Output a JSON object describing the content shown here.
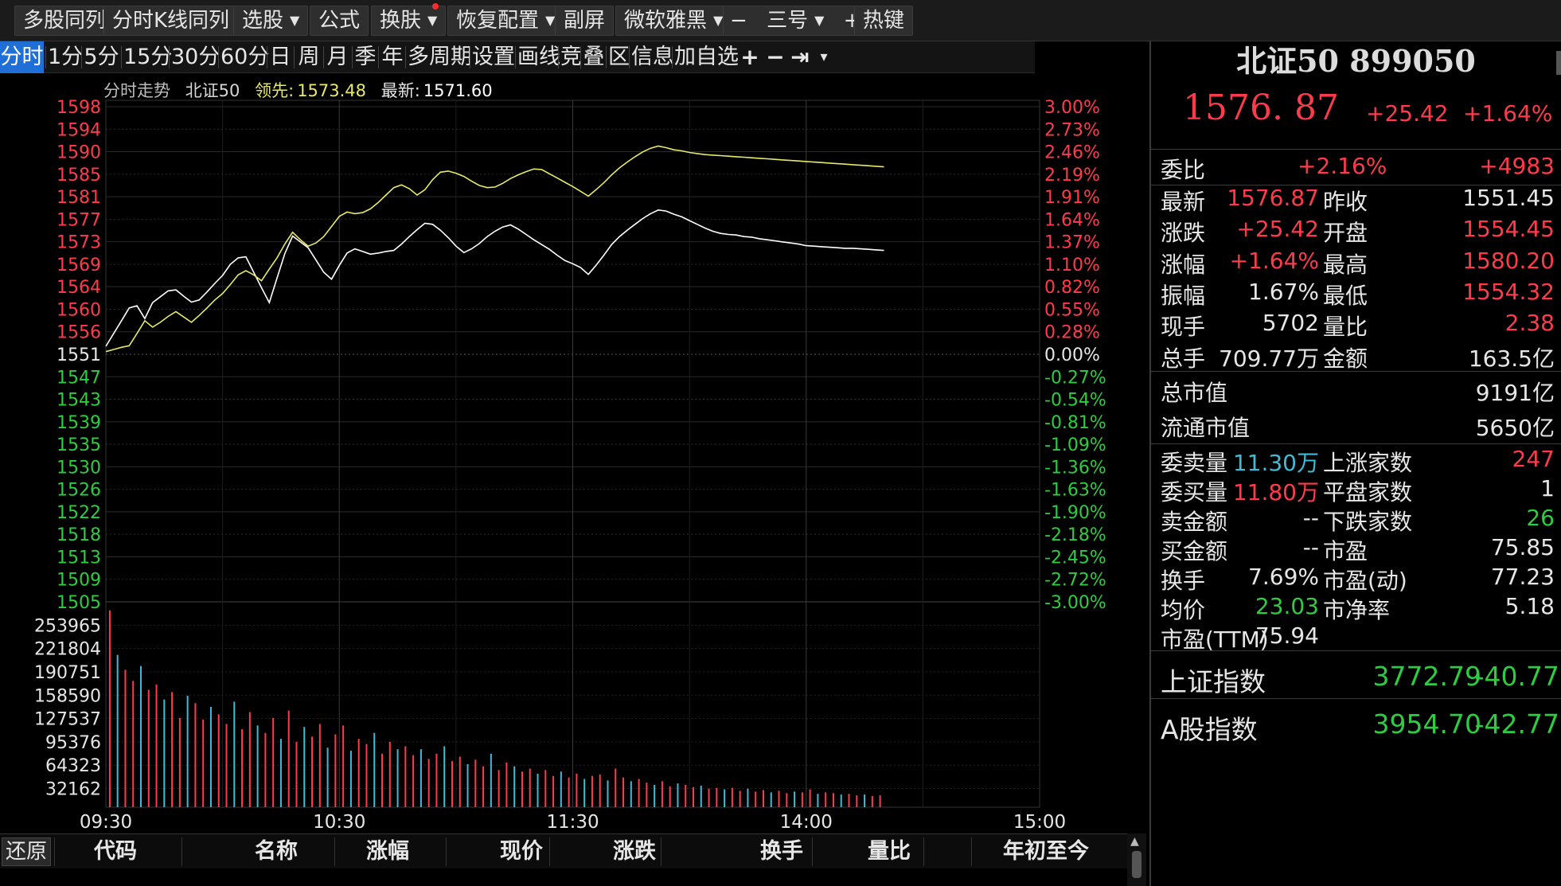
{
  "toolbar": {
    "items": [
      {
        "label": "多股同列",
        "caret": false
      },
      {
        "label": "分时K线同列",
        "caret": false
      },
      {
        "label": "选股",
        "caret": true
      },
      {
        "label": "公式",
        "caret": false
      },
      {
        "label": "换肤",
        "caret": true
      },
      {
        "label": "恢复配置",
        "caret": true
      },
      {
        "label": "副屏",
        "caret": false
      },
      {
        "label": "微软雅黑",
        "caret": true
      },
      {
        "label": "三号",
        "caret": true
      },
      {
        "label": "热键",
        "caret": false
      }
    ],
    "font_minus": "−",
    "font_plus": "+"
  },
  "periods": {
    "items": [
      "分时",
      "1分",
      "5分",
      "15分",
      "30分",
      "60分",
      "日",
      "周",
      "月",
      "季",
      "年",
      "多周期",
      "设置",
      "画线",
      "竞",
      "叠",
      "区",
      "信息",
      "加自选"
    ],
    "active": "分时",
    "tools": [
      "+",
      "−",
      "⇥",
      "▾"
    ]
  },
  "chart_info": {
    "label": "分时走势",
    "name": "北证50",
    "lead_label": "领先:",
    "lead_value": "1573.48",
    "latest_label": "最新:",
    "latest_value": "1571.60"
  },
  "chart_data": {
    "type": "line",
    "prev_close": 1551.45,
    "ylim": [
      1505,
      1598
    ],
    "price_ticks": [
      "1598",
      "1594",
      "1590",
      "1585",
      "1581",
      "1577",
      "1573",
      "1569",
      "1564",
      "1560",
      "1556",
      "1551",
      "1547",
      "1543",
      "1539",
      "1535",
      "1530",
      "1526",
      "1522",
      "1518",
      "1513",
      "1509",
      "1505"
    ],
    "pct_ticks": [
      "3.00%",
      "2.73%",
      "2.46%",
      "2.19%",
      "1.91%",
      "1.64%",
      "1.37%",
      "1.10%",
      "0.82%",
      "0.55%",
      "0.28%",
      "0.00%",
      "-0.27%",
      "-0.54%",
      "-0.81%",
      "-1.09%",
      "-1.36%",
      "-1.63%",
      "-1.90%",
      "-2.18%",
      "-2.45%",
      "-2.72%",
      "-3.00%"
    ],
    "volume_ticks": [
      "253965",
      "221804",
      "190751",
      "158590",
      "127537",
      "95376",
      "64323",
      "32162"
    ],
    "volume_max": 270000,
    "time_labels": [
      "09:30",
      "10:30",
      "11:30",
      "14:00",
      "15:00"
    ],
    "total_minutes": 240,
    "series": [
      {
        "name": "最新",
        "color": "#ffffff",
        "x": [
          0,
          2,
          4,
          6,
          8,
          10,
          12,
          14,
          16,
          18,
          20,
          22,
          24,
          26,
          28,
          30,
          32,
          34,
          36,
          38,
          40,
          42,
          44,
          46,
          48,
          50,
          52,
          54,
          56,
          58,
          60,
          62,
          64,
          66,
          68,
          70,
          72,
          74,
          76,
          78,
          80,
          82,
          84,
          86,
          88,
          90,
          92,
          94,
          96,
          98,
          100,
          102,
          104,
          106,
          108,
          110,
          112,
          114,
          116,
          118,
          120,
          122,
          124,
          126,
          128,
          130,
          132,
          134,
          136,
          138,
          140,
          142,
          144,
          146,
          148,
          150,
          152,
          154,
          156,
          158,
          160,
          162,
          164,
          166,
          168,
          170,
          172,
          174,
          176,
          178,
          180,
          182,
          184,
          186,
          188,
          190,
          192,
          194,
          196,
          198,
          200
        ],
        "values": [
          1553.0,
          1555.4,
          1557.8,
          1560.2,
          1560.6,
          1558.2,
          1561.2,
          1562.3,
          1563.4,
          1563.6,
          1562.4,
          1561.3,
          1561.7,
          1563.2,
          1564.8,
          1566.3,
          1568.4,
          1569.6,
          1569.8,
          1566.9,
          1564.0,
          1561.2,
          1565.8,
          1570.4,
          1573.7,
          1572.6,
          1571.5,
          1569.2,
          1566.9,
          1565.6,
          1568.2,
          1570.5,
          1571.3,
          1570.8,
          1570.3,
          1570.5,
          1570.8,
          1571.0,
          1572.2,
          1573.6,
          1574.9,
          1576.1,
          1575.9,
          1574.8,
          1573.4,
          1571.8,
          1570.6,
          1571.3,
          1572.3,
          1573.6,
          1574.6,
          1575.4,
          1575.8,
          1575.0,
          1574.0,
          1573.0,
          1572.1,
          1571.2,
          1570.1,
          1569.1,
          1568.5,
          1567.8,
          1566.5,
          1568.2,
          1570.1,
          1572.1,
          1573.6,
          1574.8,
          1575.9,
          1577.0,
          1577.9,
          1578.6,
          1578.4,
          1577.8,
          1577.3,
          1576.6,
          1575.9,
          1575.2,
          1574.6,
          1574.2,
          1574.0,
          1573.9,
          1573.6,
          1573.5,
          1573.2,
          1573.0,
          1572.8,
          1572.6,
          1572.4,
          1572.2,
          1571.9,
          1571.8,
          1571.7,
          1571.6,
          1571.5,
          1571.4,
          1571.4,
          1571.3,
          1571.2,
          1571.1,
          1571.0
        ]
      },
      {
        "name": "领先",
        "color": "#e8e86a",
        "x": [
          0,
          2,
          4,
          6,
          8,
          10,
          12,
          14,
          16,
          18,
          20,
          22,
          24,
          26,
          28,
          30,
          32,
          34,
          36,
          38,
          40,
          42,
          44,
          46,
          48,
          50,
          52,
          54,
          56,
          58,
          60,
          62,
          64,
          66,
          68,
          70,
          72,
          74,
          76,
          78,
          80,
          82,
          84,
          86,
          88,
          90,
          92,
          94,
          96,
          98,
          100,
          102,
          104,
          106,
          108,
          110,
          112,
          114,
          116,
          118,
          120,
          122,
          124,
          126,
          128,
          130,
          132,
          134,
          136,
          138,
          140,
          142,
          144,
          146,
          148,
          150,
          152,
          154,
          156,
          158,
          160,
          162,
          164,
          166,
          168,
          170,
          172,
          174,
          176,
          178,
          180,
          182,
          184,
          186,
          188,
          190,
          192,
          194,
          196,
          198,
          200
        ],
        "values": [
          1552.0,
          1552.4,
          1552.8,
          1553.1,
          1555.4,
          1557.8,
          1556.6,
          1557.5,
          1558.6,
          1559.5,
          1558.5,
          1557.5,
          1558.8,
          1560.2,
          1561.7,
          1562.9,
          1564.6,
          1566.4,
          1567.2,
          1566.4,
          1565.3,
          1567.5,
          1569.6,
          1572.2,
          1574.4,
          1573.0,
          1571.8,
          1572.4,
          1573.6,
          1575.5,
          1577.4,
          1578.2,
          1577.9,
          1578.1,
          1578.8,
          1580.0,
          1581.4,
          1582.8,
          1583.3,
          1582.6,
          1581.4,
          1582.4,
          1584.3,
          1585.7,
          1585.9,
          1585.5,
          1584.9,
          1584.0,
          1583.2,
          1582.8,
          1582.9,
          1583.6,
          1584.5,
          1585.2,
          1585.8,
          1586.3,
          1586.2,
          1585.4,
          1584.6,
          1583.8,
          1583.0,
          1582.1,
          1581.2,
          1582.4,
          1583.7,
          1585.2,
          1586.5,
          1587.6,
          1588.6,
          1589.5,
          1590.2,
          1590.6,
          1590.3,
          1589.9,
          1589.7,
          1589.4,
          1589.2,
          1589.0,
          1588.9,
          1588.8,
          1588.7,
          1588.6,
          1588.5,
          1588.4,
          1588.3,
          1588.2,
          1588.1,
          1588.0,
          1587.9,
          1587.8,
          1587.7,
          1587.6,
          1587.5,
          1587.4,
          1587.3,
          1587.2,
          1587.1,
          1587.0,
          1586.9,
          1586.8,
          1586.7
        ]
      }
    ],
    "volume": {
      "values": [
        265000,
        205000,
        185000,
        170000,
        190000,
        158000,
        165000,
        145000,
        155000,
        120000,
        150000,
        140000,
        118000,
        135000,
        125000,
        112000,
        142000,
        105000,
        128000,
        110000,
        100000,
        120000,
        92000,
        130000,
        88000,
        108000,
        95000,
        112000,
        80000,
        98000,
        110000,
        76000,
        92000,
        85000,
        100000,
        72000,
        88000,
        78000,
        82000,
        70000,
        78000,
        65000,
        72000,
        82000,
        62000,
        68000,
        58000,
        64000,
        55000,
        72000,
        50000,
        60000,
        55000,
        48000,
        52000,
        45000,
        50000,
        42000,
        48000,
        40000,
        45000,
        38000,
        42000,
        44000,
        36000,
        52000,
        40000,
        35000,
        38000,
        33000,
        30000,
        35000,
        28000,
        32000,
        30000,
        27000,
        29000,
        25000,
        26000,
        24000,
        26000,
        22000,
        25000,
        21000,
        23000,
        20000,
        22000,
        19000,
        21000,
        20000,
        24000,
        18000,
        20000,
        19000,
        17000,
        18000,
        16000,
        17000,
        15000,
        16000
      ],
      "up_color": "#ff3b4b",
      "down_color": "#3fbad8"
    }
  },
  "right_panel": {
    "title": "北证50 899050",
    "price": "1576. 87",
    "change": "+25.42",
    "change_pct": "+1.64%",
    "webi": {
      "label": "委比",
      "pct": "+2.16%",
      "diff": "+4983"
    },
    "grid": [
      {
        "l1": "最新",
        "v1": "1576.87",
        "c1": "red",
        "l2": "昨收",
        "v2": "1551.45",
        "c2": "white"
      },
      {
        "l1": "涨跌",
        "v1": "+25.42",
        "c1": "red",
        "l2": "开盘",
        "v2": "1554.45",
        "c2": "red"
      },
      {
        "l1": "涨幅",
        "v1": "+1.64%",
        "c1": "red",
        "l2": "最高",
        "v2": "1580.20",
        "c2": "red"
      },
      {
        "l1": "振幅",
        "v1": "1.67%",
        "c1": "white",
        "l2": "最低",
        "v2": "1554.32",
        "c2": "red"
      },
      {
        "l1": "现手",
        "v1": "5702",
        "c1": "white",
        "l2": "量比",
        "v2": "2.38",
        "c2": "red"
      },
      {
        "l1": "总手",
        "v1": "709.77万",
        "c1": "white",
        "l2": "金额",
        "v2": "163.5亿",
        "c2": "white"
      }
    ],
    "total_cap": {
      "label": "总市值",
      "value": "9191亿"
    },
    "float_cap": {
      "label": "流通市值",
      "value": "5650亿"
    },
    "grid2": [
      {
        "l1": "委卖量",
        "v1": "11.30万",
        "c1": "cyan",
        "l2": "上涨家数",
        "v2": "247",
        "c2": "red"
      },
      {
        "l1": "委买量",
        "v1": "11.80万",
        "c1": "red",
        "l2": "平盘家数",
        "v2": "1",
        "c2": "white"
      },
      {
        "l1": "卖金额",
        "v1": "--",
        "c1": "white",
        "l2": "下跌家数",
        "v2": "26",
        "c2": "green"
      },
      {
        "l1": "买金额",
        "v1": "--",
        "c1": "white",
        "l2": "市盈",
        "v2": "75.85",
        "c2": "white"
      },
      {
        "l1": "换手",
        "v1": "7.69%",
        "c1": "white",
        "l2": "市盈(动)",
        "v2": "77.23",
        "c2": "white"
      },
      {
        "l1": "均价",
        "v1": "23.03",
        "c1": "green",
        "l2": "市净率",
        "v2": "5.18",
        "c2": "white"
      },
      {
        "l1": "市盈(TTM)",
        "v1": "75.94",
        "c1": "white",
        "l2": "",
        "v2": "",
        "c2": "white"
      }
    ],
    "indices": [
      {
        "name": "上证指数",
        "value": "3772.79",
        "change": "-40.77"
      },
      {
        "name": "A股指数",
        "value": "3954.70",
        "change": "-42.77"
      }
    ]
  },
  "table": {
    "restore_label": "还原",
    "columns": [
      "代码",
      "名称",
      "涨幅",
      "现价",
      "涨跌",
      "换手",
      "量比",
      "年初至今"
    ],
    "scroll_up": "▲"
  }
}
